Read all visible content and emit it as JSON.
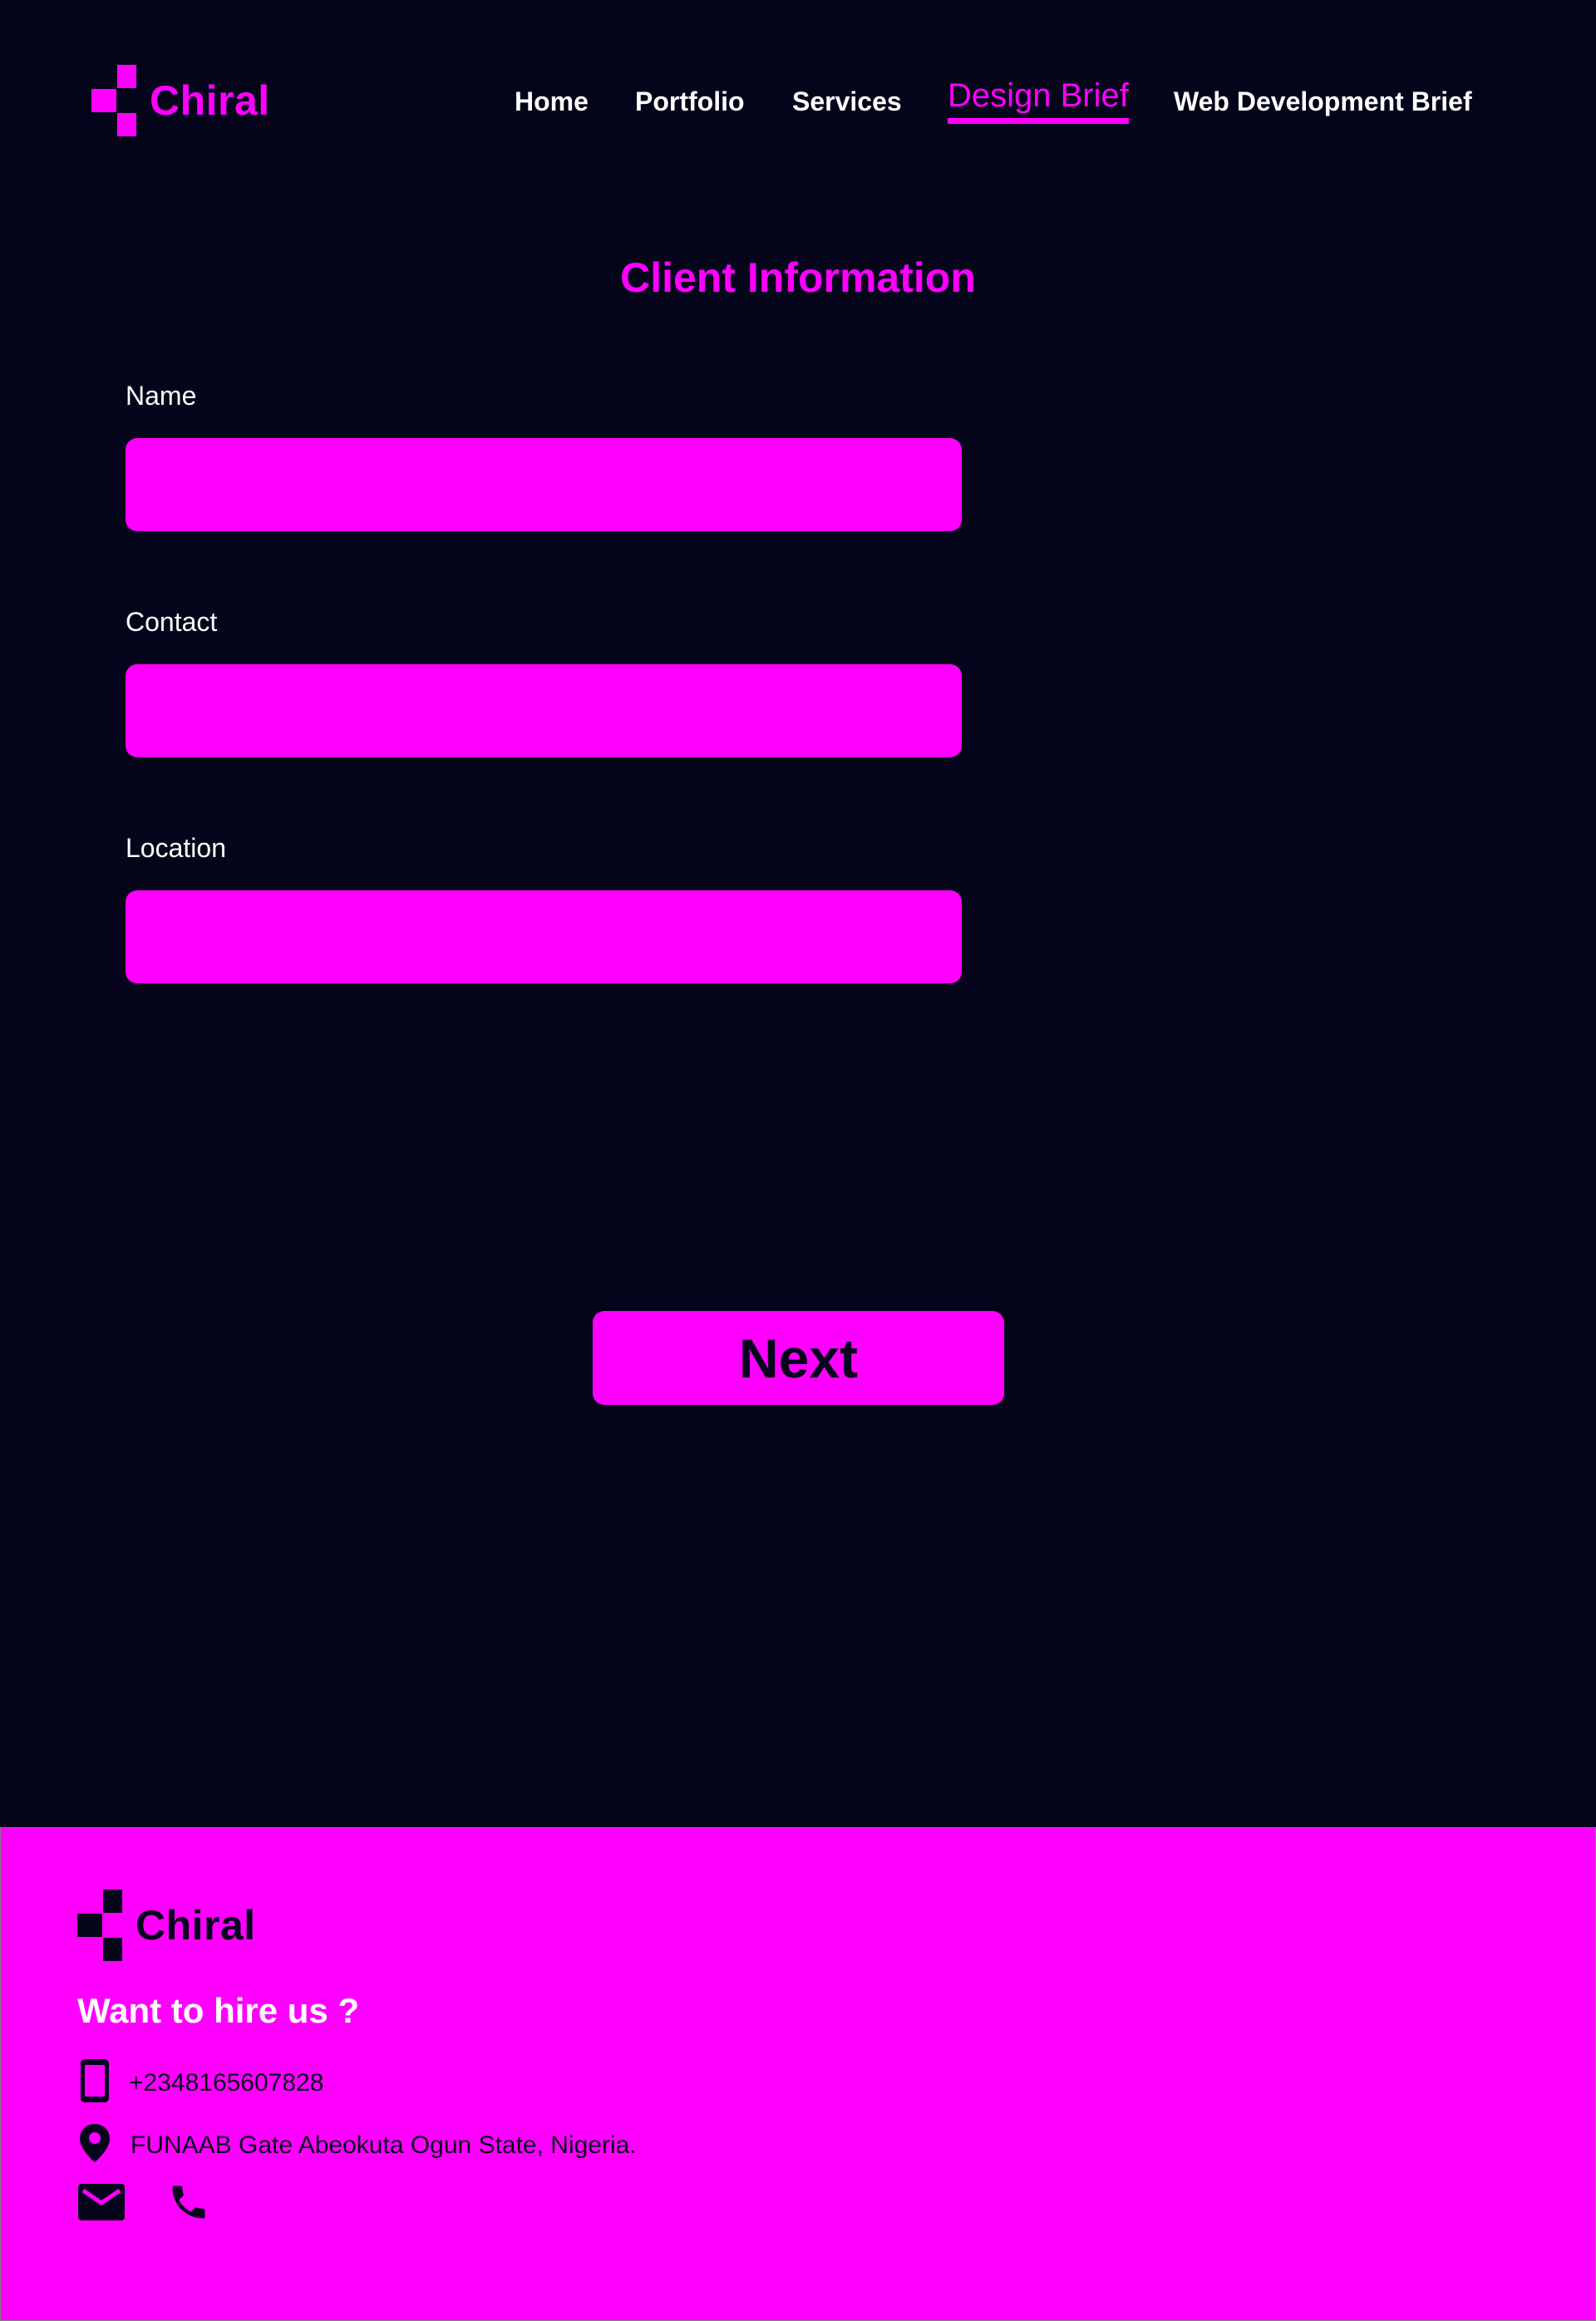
{
  "brand": {
    "name": "Chiral",
    "accent_color": "#ff00ff",
    "background_color": "#04051b"
  },
  "nav": {
    "items": [
      {
        "label": "Home"
      },
      {
        "label": "Portfolio"
      },
      {
        "label": "Services"
      },
      {
        "label": "Design Brief"
      },
      {
        "label": "Web Development Brief"
      }
    ],
    "active": "Design Brief"
  },
  "form": {
    "title": "Client Information",
    "fields": [
      {
        "label": "Name",
        "value": ""
      },
      {
        "label": "Contact",
        "value": ""
      },
      {
        "label": "Location",
        "value": ""
      }
    ],
    "next_label": "Next"
  },
  "footer": {
    "brand_name": "Chiral",
    "heading": "Want to hire us ?",
    "phone": "+2348165607828",
    "address": "FUNAAB Gate Abeokuta Ogun State, Nigeria.",
    "icons": [
      "mobile-phone-icon",
      "location-pin-icon",
      "mail-icon",
      "phone-icon"
    ]
  }
}
